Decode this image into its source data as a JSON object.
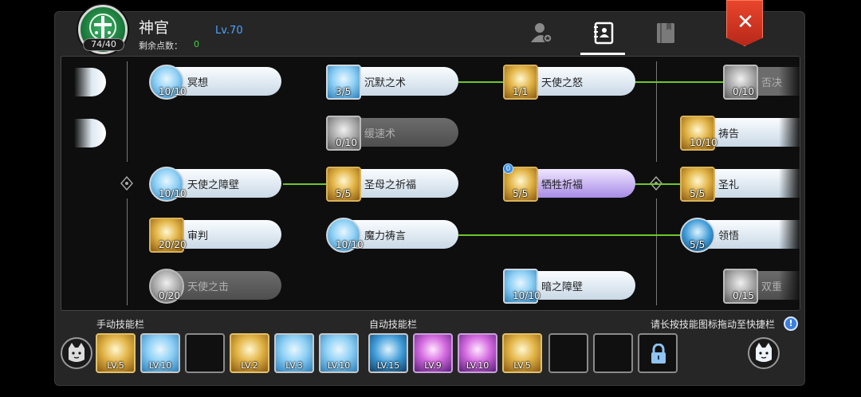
{
  "header": {
    "class_name": "神官",
    "level": "Lv.70",
    "points_label": "剩余点数：",
    "points_value": "0",
    "emblem_count": "74/40",
    "tabs": [
      "character-icon",
      "skill-book-icon",
      "journal-icon"
    ],
    "close_symbol": "✕"
  },
  "tree": {
    "nodes": [
      {
        "name": "冥想",
        "count": "10/10",
        "style": "blue-round",
        "state": "active"
      },
      {
        "name": "沉默之术",
        "count": "3/5",
        "style": "blue-square",
        "state": "active"
      },
      {
        "name": "天使之怒",
        "count": "1/1",
        "style": "gold-square",
        "state": "active"
      },
      {
        "name": "否决",
        "count": "0/10",
        "style": "grey-square",
        "state": "locked"
      },
      {
        "name": "缓速术",
        "count": "0/10",
        "style": "grey-square",
        "state": "locked"
      },
      {
        "name": "祷告",
        "count": "10/10",
        "style": "gold-square",
        "state": "active"
      },
      {
        "name": "天使之障壁",
        "count": "10/10",
        "style": "blue-round",
        "state": "active"
      },
      {
        "name": "圣母之祈福",
        "count": "5/5",
        "style": "gold-square",
        "state": "active"
      },
      {
        "name": "牺牲祈福",
        "count": "5/5",
        "style": "gold-square",
        "state": "selected",
        "badge": "0"
      },
      {
        "name": "圣礼",
        "count": "5/5",
        "style": "gold-square",
        "state": "active"
      },
      {
        "name": "审判",
        "count": "20/20",
        "style": "gold-square",
        "state": "active"
      },
      {
        "name": "魔力祷言",
        "count": "10/10",
        "style": "blue-round",
        "state": "active"
      },
      {
        "name": "领悟",
        "count": "5/5",
        "style": "dblue-round",
        "state": "active"
      },
      {
        "name": "天使之击",
        "count": "0/20",
        "style": "grey-round",
        "state": "locked"
      },
      {
        "name": "暗之障壁",
        "count": "10/10",
        "style": "blue-square",
        "state": "active"
      },
      {
        "name": "双重",
        "count": "0/15",
        "style": "grey-square",
        "state": "locked"
      }
    ]
  },
  "bars": {
    "manual_title": "手动技能栏",
    "auto_title": "自动技能栏",
    "hint": "请长按技能图标拖动至快捷栏",
    "manual_slots": [
      {
        "lv": "LV.5",
        "style": "gold"
      },
      {
        "lv": "LV.10",
        "style": "blue"
      },
      {
        "lv": "",
        "style": "empty"
      },
      {
        "lv": "LV.2",
        "style": "gold"
      },
      {
        "lv": "LV.3",
        "style": "blue"
      },
      {
        "lv": "LV.10",
        "style": "blue"
      }
    ],
    "auto_slots": [
      {
        "lv": "LV.15",
        "style": "blue"
      },
      {
        "lv": "LV.9",
        "style": "purple"
      },
      {
        "lv": "LV.10",
        "style": "purple"
      },
      {
        "lv": "LV.5",
        "style": "gold"
      },
      {
        "lv": "",
        "style": "empty"
      },
      {
        "lv": "",
        "style": "empty"
      },
      {
        "lv": "",
        "style": "locked"
      }
    ]
  }
}
